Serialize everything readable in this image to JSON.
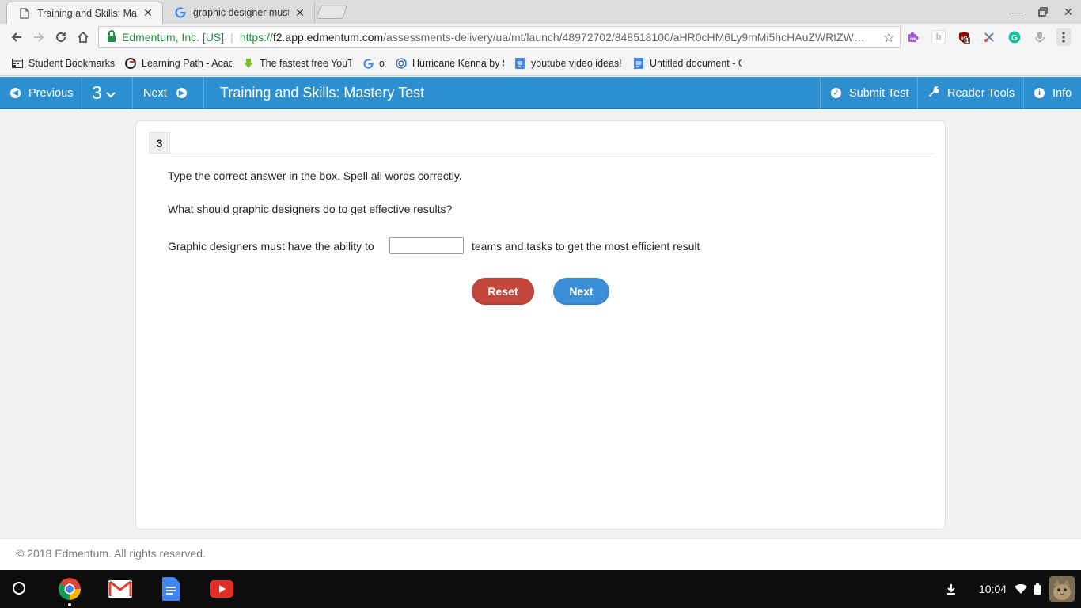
{
  "browser": {
    "tabs": [
      {
        "title": "Training and Skills: Mast",
        "active": true
      },
      {
        "title": "graphic designer must h",
        "active": false
      }
    ],
    "url": {
      "secure_label": "Edmentum, Inc. [US]",
      "scheme": "https://",
      "host": "f2.app.edmentum.com",
      "path": "/assessments-delivery/ua/mt/launch/48972702/848518100/aHR0cHM6Ly9mMi5hcHAuZWRtZW…"
    },
    "extension_badge": "1",
    "bookmarks": [
      {
        "label": "Student Bookmarks",
        "icon": "apps-grid-icon"
      },
      {
        "label": "Learning Path - Acad",
        "icon": "edmentum-icon"
      },
      {
        "label": "The fastest free YouT",
        "icon": "download-arrow-icon"
      },
      {
        "label": "o",
        "icon": "google-icon"
      },
      {
        "label": "Hurricane Kenna by S",
        "icon": "globe-icon"
      },
      {
        "label": "youtube video ideas!",
        "icon": "doc-icon"
      },
      {
        "label": "Untitled document - G",
        "icon": "doc-icon"
      }
    ]
  },
  "app": {
    "previous_label": "Previous",
    "question_selector": "3",
    "next_label": "Next",
    "title": "Training and Skills: Mastery Test",
    "submit_label": "Submit Test",
    "reader_tools_label": "Reader Tools",
    "info_label": "Info",
    "accent_color": "#2d8fcf"
  },
  "question": {
    "number": "3",
    "instruction": "Type the correct answer in the box. Spell all words correctly.",
    "prompt": "What should graphic designers do to get effective results?",
    "sentence_before": "Graphic designers must have the ability to",
    "sentence_after": "teams and tasks to get the most efficient result",
    "answer_value": "",
    "reset_label": "Reset",
    "next_label": "Next"
  },
  "footer": {
    "copyright": "© 2018 Edmentum. All rights reserved."
  },
  "shelf": {
    "apps": [
      "chrome-icon",
      "gmail-icon",
      "docs-icon",
      "youtube-icon"
    ],
    "time": "10:04"
  }
}
